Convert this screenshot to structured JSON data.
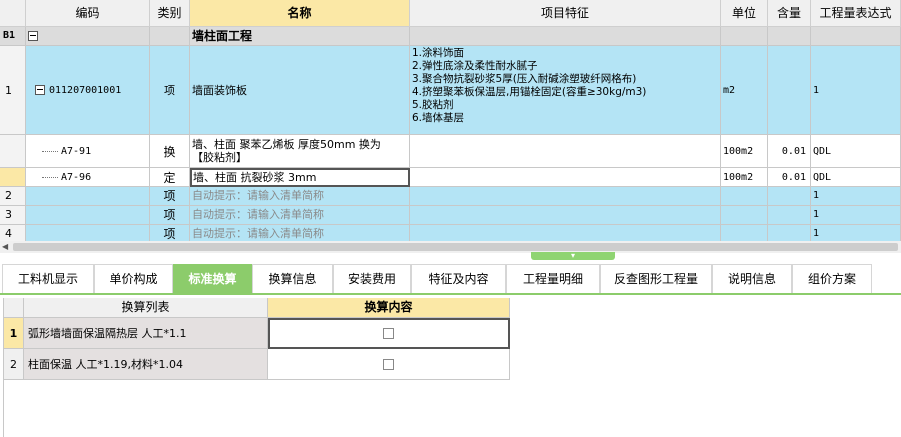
{
  "grid": {
    "headers": {
      "code": "编码",
      "type": "类别",
      "name": "名称",
      "features": "项目特征",
      "unit": "单位",
      "qty": "含量",
      "expr": "工程量表达式"
    },
    "section": {
      "id": "B1",
      "name": "墙柱面工程"
    },
    "item1": {
      "row_no": "1",
      "code": "011207001001",
      "type": "项",
      "name": "墙面装饰板",
      "features": [
        "1.涂料饰面",
        "2.弹性底涂及柔性耐水腻子",
        "3.聚合物抗裂砂浆5厚(压入耐碱涂塑玻纤网格布)",
        "4.挤塑聚苯板保温层,用锚栓固定(容重≥30kg/m3)",
        "5.胶粘剂",
        "6.墙体基层"
      ],
      "unit": "m2",
      "expr": "1"
    },
    "sub1": {
      "code": "A7-91",
      "type": "换",
      "name_line1": "墙、柱面 聚苯乙烯板 厚度50mm  换为",
      "name_line2": "【胶粘剂】",
      "unit": "100m2",
      "qty": "0.01",
      "expr": "QDL"
    },
    "sub2": {
      "code": "A7-96",
      "type": "定",
      "name": "墙、柱面 抗裂砂浆 3mm",
      "unit": "100m2",
      "qty": "0.01",
      "expr": "QDL"
    },
    "hint_rows": [
      {
        "row_no": "2",
        "type": "项",
        "hint": "自动提示：请输入清单简称",
        "expr": "1"
      },
      {
        "row_no": "3",
        "type": "项",
        "hint": "自动提示：请输入清单简称",
        "expr": "1"
      },
      {
        "row_no": "4",
        "type": "项",
        "hint": "自动提示：请输入清单简称",
        "expr": "1"
      }
    ]
  },
  "tabs": [
    "工料机显示",
    "单价构成",
    "标准换算",
    "换算信息",
    "安装费用",
    "特征及内容",
    "工程量明细",
    "反查图形工程量",
    "说明信息",
    "组价方案"
  ],
  "active_tab": "标准换算",
  "conversion": {
    "headers": {
      "list": "换算列表",
      "content": "换算内容"
    },
    "rows": [
      {
        "no": "1",
        "name": "弧形墙墙面保温隔热层 人工*1.1",
        "checked": false
      },
      {
        "no": "2",
        "name": "柱面保温 人工*1.19,材料*1.04",
        "checked": false
      }
    ]
  },
  "colors": {
    "row_blue": "#b4e4f5",
    "header_highlight": "#fbe8a6",
    "tab_active": "#8ccc6b"
  }
}
